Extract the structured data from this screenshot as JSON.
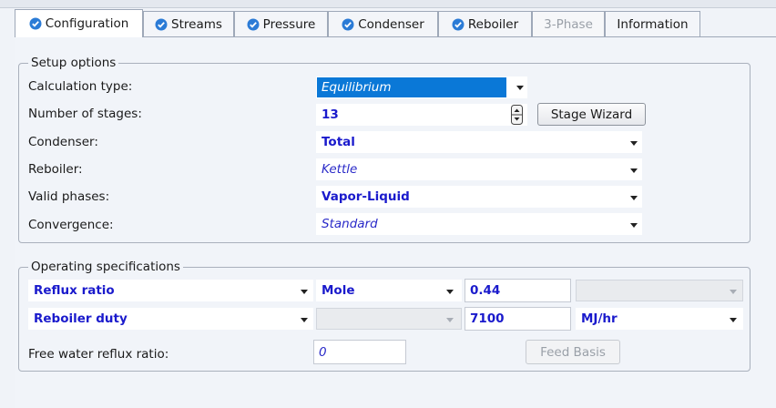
{
  "tabs": [
    {
      "label": "Configuration",
      "icon": "check-circle-icon",
      "state": "active"
    },
    {
      "label": "Streams",
      "icon": "check-circle-icon",
      "state": "normal"
    },
    {
      "label": "Pressure",
      "icon": "check-circle-icon",
      "state": "normal"
    },
    {
      "label": "Condenser",
      "icon": "check-circle-icon",
      "state": "normal"
    },
    {
      "label": "Reboiler",
      "icon": "check-circle-icon",
      "state": "normal"
    },
    {
      "label": "3-Phase",
      "icon": null,
      "state": "disabled"
    },
    {
      "label": "Information",
      "icon": null,
      "state": "normal"
    }
  ],
  "setup": {
    "title": "Setup options",
    "calculation_type": {
      "label": "Calculation type:",
      "value": "Equilibrium"
    },
    "number_of_stages": {
      "label": "Number of stages:",
      "value": "13"
    },
    "stage_wizard_label": "Stage Wizard",
    "condenser": {
      "label": "Condenser:",
      "value": "Total"
    },
    "reboiler": {
      "label": "Reboiler:",
      "value": "Kettle"
    },
    "valid_phases": {
      "label": "Valid phases:",
      "value": "Vapor-Liquid"
    },
    "convergence": {
      "label": "Convergence:",
      "value": "Standard"
    }
  },
  "operating": {
    "title": "Operating specifications",
    "row1": {
      "spec": "Reflux ratio",
      "basis": "Mole",
      "value": "0.44",
      "units": ""
    },
    "row2": {
      "spec": "Reboiler duty",
      "basis": "",
      "value": "7100",
      "units": "MJ/hr"
    },
    "free_water": {
      "label": "Free water reflux ratio:",
      "value": "0"
    },
    "feed_basis_label": "Feed Basis"
  },
  "colors": {
    "accent_blue": "#1a1acc",
    "selection": "#0a78d7",
    "tab_icon": "#2b7bd6"
  }
}
